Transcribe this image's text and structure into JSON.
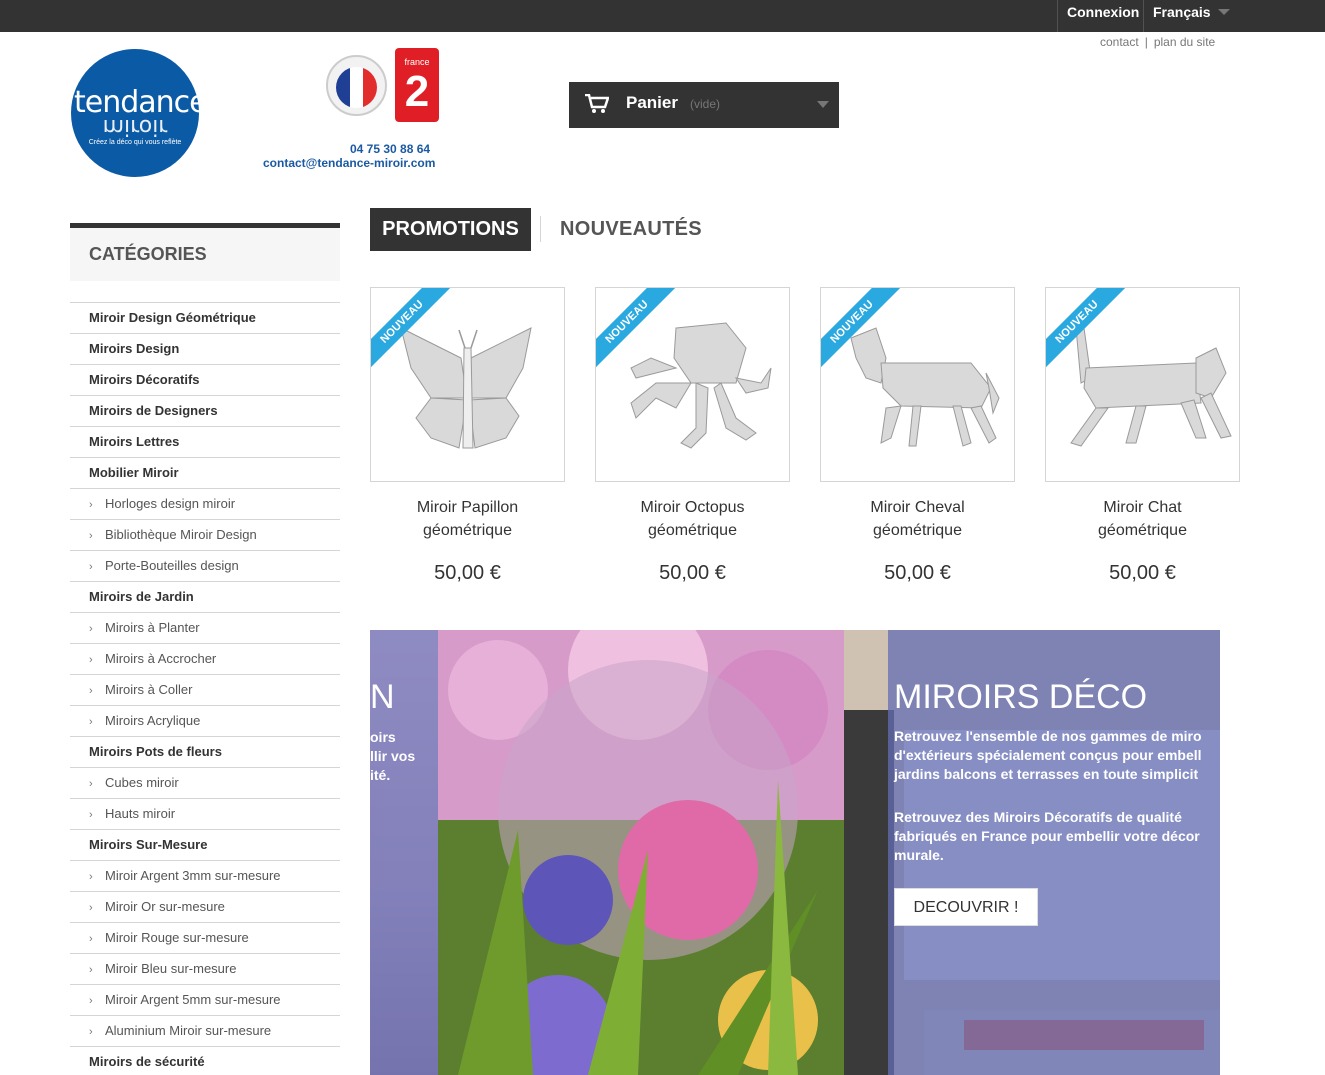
{
  "topbar": {
    "login": "Connexion",
    "language": "Français"
  },
  "toplinks": {
    "contact": "contact",
    "sitemap": "plan du site"
  },
  "header": {
    "logo_main": "tendance",
    "logo_mirror": "miroir",
    "logo_tagline": "Créez la déco qui vous reflète",
    "france2_small": "france",
    "france2_big": "2",
    "phone": "04 75 30 88 64",
    "email": "contact@tendance-miroir.com"
  },
  "cart": {
    "label": "Panier",
    "status": "(vide)"
  },
  "sidebar": {
    "title": "CATÉGORIES",
    "items": [
      {
        "label": "Miroir Design Géométrique",
        "level": "top"
      },
      {
        "label": "Miroirs Design",
        "level": "top"
      },
      {
        "label": "Miroirs Décoratifs",
        "level": "top"
      },
      {
        "label": "Miroirs de Designers",
        "level": "top"
      },
      {
        "label": "Miroirs Lettres",
        "level": "top"
      },
      {
        "label": "Mobilier Miroir",
        "level": "top"
      },
      {
        "label": "Horloges design miroir",
        "level": "sub"
      },
      {
        "label": "Bibliothèque Miroir Design",
        "level": "sub"
      },
      {
        "label": "Porte-Bouteilles design",
        "level": "sub"
      },
      {
        "label": "Miroirs de Jardin",
        "level": "top"
      },
      {
        "label": "Miroirs à Planter",
        "level": "sub"
      },
      {
        "label": "Miroirs à Accrocher",
        "level": "sub"
      },
      {
        "label": "Miroirs à Coller",
        "level": "sub"
      },
      {
        "label": "Miroirs Acrylique",
        "level": "sub"
      },
      {
        "label": "Miroirs Pots de fleurs",
        "level": "top"
      },
      {
        "label": "Cubes miroir",
        "level": "sub"
      },
      {
        "label": "Hauts miroir",
        "level": "sub"
      },
      {
        "label": "Miroirs Sur-Mesure",
        "level": "top"
      },
      {
        "label": "Miroir Argent 3mm sur-mesure",
        "level": "sub"
      },
      {
        "label": "Miroir Or sur-mesure",
        "level": "sub"
      },
      {
        "label": "Miroir Rouge sur-mesure",
        "level": "sub"
      },
      {
        "label": "Miroir Bleu sur-mesure",
        "level": "sub"
      },
      {
        "label": "Miroir Argent 5mm sur-mesure",
        "level": "sub"
      },
      {
        "label": "Aluminium Miroir sur-mesure",
        "level": "sub"
      },
      {
        "label": "Miroirs de sécurité",
        "level": "top"
      }
    ]
  },
  "tabs": {
    "active": "PROMOTIONS",
    "other": "NOUVEAUTÉS"
  },
  "products": [
    {
      "ribbon": "NOUVEAU",
      "name_line1": "Miroir Papillon",
      "name_line2": "géométrique",
      "price": "50,00 €"
    },
    {
      "ribbon": "NOUVEAU",
      "name_line1": "Miroir Octopus",
      "name_line2": "géométrique",
      "price": "50,00 €"
    },
    {
      "ribbon": "NOUVEAU",
      "name_line1": "Miroir Cheval",
      "name_line2": "géométrique",
      "price": "50,00 €"
    },
    {
      "ribbon": "NOUVEAU",
      "name_line1": "Miroir Chat",
      "name_line2": "géométrique",
      "price": "50,00 €"
    }
  ],
  "banner": {
    "left_title": "N",
    "left_line1": "oirs",
    "left_line2": "llir vos",
    "left_line3": "ité.",
    "title": "MIROIRS DÉCO",
    "p1_line1": "Retrouvez l'ensemble de nos gammes de miro",
    "p1_line2": "d'extérieurs spécialement conçus pour embell",
    "p1_line3": "jardins balcons et terrasses en toute simplicit",
    "p2_line1": "Retrouvez des Miroirs Décoratifs de qualité",
    "p2_line2": "fabriqués en France pour embellir votre décor",
    "p2_line3": "murale.",
    "button": "DECOUVRIR !"
  },
  "colors": {
    "dark": "#333333",
    "ribbon": "#2aa8e0",
    "brand_blue": "#0b5aa6",
    "link_blue": "#1b5aa2"
  }
}
